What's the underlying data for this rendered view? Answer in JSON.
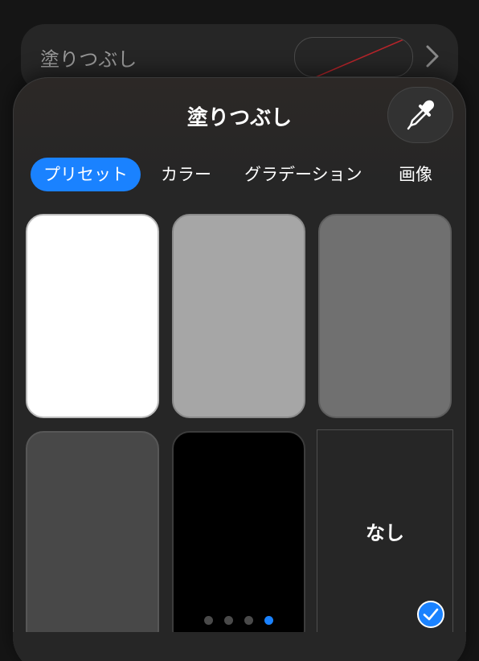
{
  "background_row": {
    "label": "塗りつぶし"
  },
  "popover": {
    "title": "塗りつぶし",
    "eyedropper_icon": "eyedropper-icon",
    "tabs": [
      {
        "label": "プリセット",
        "active": true
      },
      {
        "label": "カラー",
        "active": false
      },
      {
        "label": "グラデーション",
        "active": false
      },
      {
        "label": "画像",
        "active": false
      }
    ],
    "presets": [
      {
        "name": "white",
        "color": "#ffffff"
      },
      {
        "name": "light-gray",
        "color": "#a6a6a6"
      },
      {
        "name": "mid-gray",
        "color": "#707070"
      },
      {
        "name": "dark-gray",
        "color": "#484848"
      },
      {
        "name": "black",
        "color": "#000000"
      },
      {
        "name": "none",
        "label": "なし",
        "selected": true
      }
    ],
    "page_count": 4,
    "current_page": 4
  },
  "colors": {
    "accent": "#1a82ff",
    "popover_bg": "#262626"
  }
}
